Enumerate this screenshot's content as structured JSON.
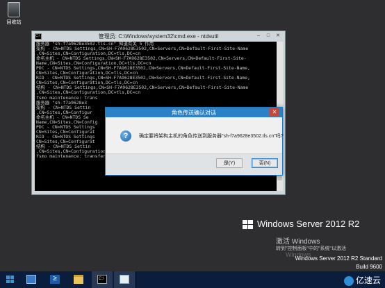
{
  "desktop": {
    "recycle_bin_label": "回收站"
  },
  "cmd_window": {
    "icon_text": "C:\\",
    "title": "管理员: C:\\Windows\\system32\\cmd.exe - ntdsutil",
    "controls": [
      "–",
      "□",
      "✕"
    ],
    "lines": [
      "服务器 \"sh-f7a9628e3502.tls.cn\" 知道有关 5 作用",
      "架构 - CN=NTDS Settings,CN=SH-F7A9628E3502,CN=Servers,CN=Default-First-Site-Name",
      ",CN=Sites,CN=Configuration,DC=tls,DC=cn",
      "命名主机 - CN=NTDS Settings,CN=SH-F7A9628E3502,CN=Servers,CN=Default-First-Site-",
      "Name,CN=Sites,CN=Configuration,DC=tls,DC=cn",
      "PDC - CN=NTDS Settings,CN=SH-F7A9628E3502,CN=Servers,CN=Default-First-Site-Name,",
      "CN=Sites,CN=Configuration,DC=tls,DC=cn",
      "RID - CN=NTDS Settings,CN=SH-F7A9628E3502,CN=Servers,CN=Default-First-Site-Name,",
      "CN=Sites,CN=Configuration,DC=tls,DC=cn",
      "结构 - CN=NTDS Settings,CN=SH-F7A9628E3502,CN=Servers,CN=Default-First-Site-Name",
      ",CN=Sites,CN=Configuration,DC=tls,DC=cn",
      "fsmo maintenance: trans",
      "服务器 \"sh-f7a9628e3",
      "架构 - CN=NTDS Settin",
      ",CN=Sites,CN=Configur",
      "命名主机 - CN=NTDS Se",
      "Name,CN=Sites,CN=Config",
      "PDC - CN=NTDS Settings",
      "CN=Sites,CN=Configurat",
      "RID - CN=NTDS Settings",
      "CN=Sites,CN=Configurat",
      "结构 - CN=NTDS Settin",
      ",CN=Sites,CN=Configuration,DC=tls,DC=cn",
      "fsmo maintenance: transfer schema master"
    ]
  },
  "dialog": {
    "title": "角色传送确认对话",
    "close_glyph": "✕",
    "icon_glyph": "?",
    "message": "确定要将架构主机的角色传送到服务器\"sh-f7a9628e3502.tls.cn\"吗?",
    "yes_label": "是(Y)",
    "no_label": "否(N)"
  },
  "branding": {
    "os_name": "Windows Server 2012 R2",
    "activate_title": "激活 Windows",
    "activate_desc": "转到\"控制面板\"中的\"系统\"以激活",
    "activate_faint": "Windows",
    "version_line": "Windows Server 2012 R2 Standard",
    "build_line": "Build 9600"
  },
  "taskbar": {
    "ps_glyph": "≥",
    "cmd_glyph": "C:\\",
    "watermark": "亿速云"
  },
  "colors": {
    "desktop": "#2e2e30",
    "taskbar": "#0b1d3d",
    "dialog_titlebar": "#2b80c6",
    "close_button": "#c7463b"
  }
}
